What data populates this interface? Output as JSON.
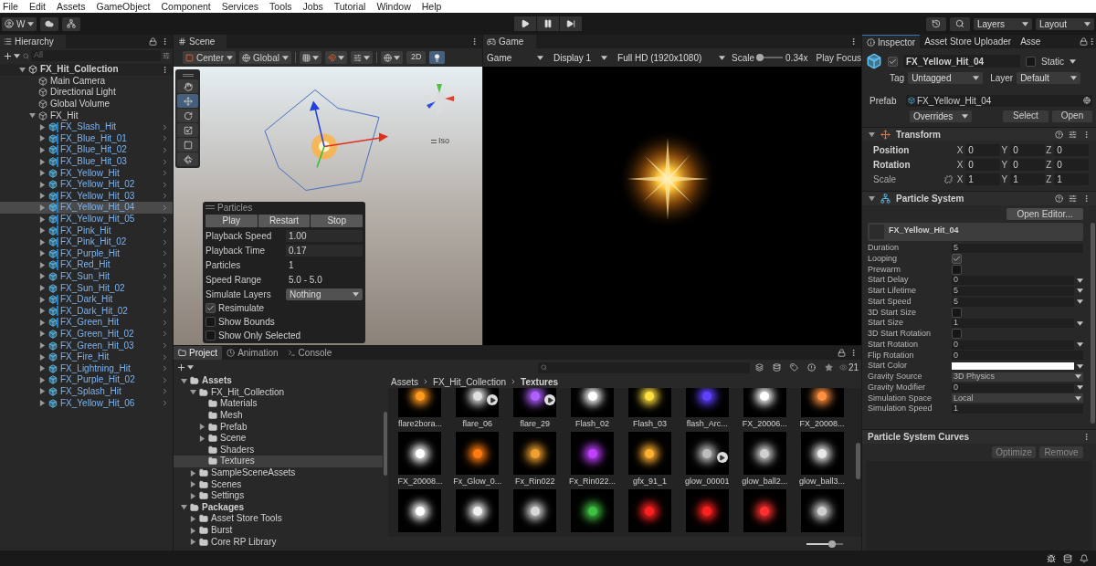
{
  "menu": [
    "File",
    "Edit",
    "Assets",
    "GameObject",
    "Component",
    "Services",
    "Tools",
    "Jobs",
    "Tutorial",
    "Window",
    "Help"
  ],
  "toolbar": {
    "account": "W",
    "layers": "Layers",
    "layout": "Layout"
  },
  "hierarchy": {
    "title": "Hierarchy",
    "search_placeholder": "All",
    "items": [
      {
        "name": "FX_Hit_Collection",
        "kind": "scene",
        "expanded": true,
        "selected": false,
        "marked": false,
        "children": [
          {
            "name": "Main Camera",
            "kind": "object",
            "selected": false,
            "marked": false
          },
          {
            "name": "Directional Light",
            "kind": "object",
            "selected": false,
            "marked": false
          },
          {
            "name": "Global Volume",
            "kind": "object",
            "selected": false,
            "marked": false
          },
          {
            "name": "FX_Hit",
            "kind": "object",
            "expanded": true,
            "selected": false,
            "marked": false,
            "children": [
              {
                "name": "FX_Slash_Hit",
                "kind": "prefab",
                "expanded": false,
                "selected": false,
                "marked": true
              },
              {
                "name": "FX_Blue_Hit_01",
                "kind": "prefab",
                "expanded": false,
                "selected": false,
                "marked": true
              },
              {
                "name": "FX_Blue_Hit_02",
                "kind": "prefab",
                "expanded": false,
                "selected": false,
                "marked": true
              },
              {
                "name": "FX_Blue_Hit_03",
                "kind": "prefab",
                "expanded": false,
                "selected": false,
                "marked": true
              },
              {
                "name": "FX_Yellow_Hit",
                "kind": "prefab",
                "expanded": false,
                "selected": false,
                "marked": false
              },
              {
                "name": "FX_Yellow_Hit_02",
                "kind": "prefab",
                "expanded": false,
                "selected": false,
                "marked": false
              },
              {
                "name": "FX_Yellow_Hit_03",
                "kind": "prefab",
                "expanded": false,
                "selected": false,
                "marked": true
              },
              {
                "name": "FX_Yellow_Hit_04",
                "kind": "prefab",
                "expanded": false,
                "selected": true,
                "marked": true
              },
              {
                "name": "FX_Yellow_Hit_05",
                "kind": "prefab",
                "expanded": false,
                "selected": false,
                "marked": true
              },
              {
                "name": "FX_Pink_Hit",
                "kind": "prefab",
                "expanded": false,
                "selected": false,
                "marked": true
              },
              {
                "name": "FX_Pink_Hit_02",
                "kind": "prefab",
                "expanded": false,
                "selected": false,
                "marked": true
              },
              {
                "name": "FX_Purple_Hit",
                "kind": "prefab",
                "expanded": false,
                "selected": false,
                "marked": true
              },
              {
                "name": "FX_Red_Hit",
                "kind": "prefab",
                "expanded": false,
                "selected": false,
                "marked": true
              },
              {
                "name": "FX_Sun_Hit",
                "kind": "prefab",
                "expanded": false,
                "selected": false,
                "marked": false
              },
              {
                "name": "FX_Sun_Hit_02",
                "kind": "prefab",
                "expanded": false,
                "selected": false,
                "marked": false
              },
              {
                "name": "FX_Dark_Hit",
                "kind": "prefab",
                "expanded": false,
                "selected": false,
                "marked": true
              },
              {
                "name": "FX_Dark_Hit_02",
                "kind": "prefab",
                "expanded": false,
                "selected": false,
                "marked": true
              },
              {
                "name": "FX_Green_Hit",
                "kind": "prefab",
                "expanded": false,
                "selected": false,
                "marked": true
              },
              {
                "name": "FX_Green_Hit_02",
                "kind": "prefab",
                "expanded": false,
                "selected": false,
                "marked": false
              },
              {
                "name": "FX_Green_Hit_03",
                "kind": "prefab",
                "expanded": false,
                "selected": false,
                "marked": false
              },
              {
                "name": "FX_Fire_Hit",
                "kind": "prefab",
                "expanded": false,
                "selected": false,
                "marked": false
              },
              {
                "name": "FX_Lightning_Hit",
                "kind": "prefab",
                "expanded": false,
                "selected": false,
                "marked": false
              },
              {
                "name": "FX_Purple_Hit_02",
                "kind": "prefab",
                "expanded": false,
                "selected": false,
                "marked": false
              },
              {
                "name": "FX_Splash_Hit",
                "kind": "prefab",
                "expanded": false,
                "selected": false,
                "marked": false
              },
              {
                "name": "FX_Yellow_Hit_06",
                "kind": "prefab",
                "expanded": false,
                "selected": false,
                "marked": false
              }
            ]
          }
        ]
      }
    ]
  },
  "scene": {
    "tab": "Scene",
    "pivot": "Center",
    "space": "Global",
    "mode": "2D",
    "lighting": true,
    "iso": "Iso",
    "tools": [
      {
        "kind": "hand",
        "selected": false
      },
      {
        "kind": "move",
        "selected": true
      },
      {
        "kind": "rotate",
        "selected": false
      },
      {
        "kind": "scale",
        "selected": false
      },
      {
        "kind": "rect",
        "selected": false
      },
      {
        "kind": "transform",
        "selected": false
      }
    ]
  },
  "particles": {
    "title": "Particles",
    "buttons": [
      "Play",
      "Restart",
      "Stop"
    ],
    "rows": [
      {
        "kind": "field",
        "label": "Playback Speed",
        "value": "1.00"
      },
      {
        "kind": "field",
        "label": "Playback Time",
        "value": "0.17"
      },
      {
        "kind": "text",
        "label": "Particles",
        "value": "1"
      },
      {
        "kind": "text",
        "label": "Speed Range",
        "value": "5.0 - 5.0"
      },
      {
        "kind": "dropdown",
        "label": "Simulate Layers",
        "value": "Nothing"
      }
    ],
    "checks": [
      {
        "label": "Resimulate",
        "checked": true
      },
      {
        "label": "Show Bounds",
        "checked": false
      },
      {
        "label": "Show Only Selected",
        "checked": false
      }
    ]
  },
  "game": {
    "tab": "Game",
    "view": "Game",
    "display": "Display 1",
    "resolution": "Full HD (1920x1080)",
    "scale_label": "Scale",
    "scale_slider": {
      "level": 0.12
    },
    "scale": "0.34x",
    "play_focus": "Play Focus"
  },
  "inspector": {
    "tabs": [
      {
        "label": "Inspector",
        "selected": true
      },
      {
        "label": "Asset Store Uploader",
        "selected": false
      },
      {
        "label": "Asse",
        "selected": false
      }
    ],
    "active": true,
    "name": "FX_Yellow_Hit_04",
    "static": false,
    "static_label": "Static",
    "tag_label": "Tag",
    "tag": "Untagged",
    "layer_label": "Layer",
    "layer": "Default",
    "prefab_label": "Prefab",
    "prefab": "FX_Yellow_Hit_04",
    "overrides": "Overrides",
    "select": "Select",
    "open": "Open",
    "transform": {
      "title": "Transform",
      "rows": [
        {
          "label": "Position",
          "bold": true,
          "values": [
            {
              "axis": "X",
              "value": "0"
            },
            {
              "axis": "Y",
              "value": "0"
            },
            {
              "axis": "Z",
              "value": "0"
            }
          ]
        },
        {
          "label": "Rotation",
          "bold": true,
          "values": [
            {
              "axis": "X",
              "value": "0"
            },
            {
              "axis": "Y",
              "value": "0"
            },
            {
              "axis": "Z",
              "value": "0"
            }
          ]
        },
        {
          "label": "Scale",
          "bold": false,
          "values": [
            {
              "axis": "X",
              "value": "1"
            },
            {
              "axis": "Y",
              "value": "1"
            },
            {
              "axis": "Z",
              "value": "1"
            }
          ]
        }
      ]
    },
    "particle_system": {
      "title": "Particle System",
      "open_editor": "Open Editor...",
      "module": "FX_Yellow_Hit_04",
      "props": [
        {
          "kind": "field",
          "label": "Duration",
          "value": "5"
        },
        {
          "kind": "check",
          "label": "Looping",
          "checked": true
        },
        {
          "kind": "check",
          "label": "Prewarm",
          "checked": false
        },
        {
          "kind": "curve",
          "label": "Start Delay",
          "value": "0"
        },
        {
          "kind": "curve",
          "label": "Start Lifetime",
          "value": "5"
        },
        {
          "kind": "curve",
          "label": "Start Speed",
          "value": "5"
        },
        {
          "kind": "check",
          "label": "3D Start Size",
          "checked": false
        },
        {
          "kind": "curve",
          "label": "Start Size",
          "value": "1"
        },
        {
          "kind": "check",
          "label": "3D Start Rotation",
          "checked": false
        },
        {
          "kind": "curve",
          "label": "Start Rotation",
          "value": "0"
        },
        {
          "kind": "field",
          "label": "Flip Rotation",
          "value": "0"
        },
        {
          "kind": "color",
          "label": "Start Color",
          "color": "#ffffff"
        },
        {
          "kind": "dropdown",
          "label": "Gravity Source",
          "value": "3D Physics"
        },
        {
          "kind": "curve",
          "label": "Gravity Modifier",
          "value": "0"
        },
        {
          "kind": "dropdown",
          "label": "Simulation Space",
          "value": "Local"
        },
        {
          "kind": "field",
          "label": "Simulation Speed",
          "value": "1"
        }
      ]
    },
    "curves": {
      "title": "Particle System Curves",
      "buttons": [
        "Optimize",
        "Remove"
      ]
    }
  },
  "project": {
    "tabs": [
      {
        "label": "Project",
        "kind": "project",
        "selected": true
      },
      {
        "label": "Animation",
        "kind": "animation",
        "selected": false
      },
      {
        "label": "Console",
        "kind": "console",
        "selected": false
      }
    ],
    "count": "21",
    "thumbnail_size": {
      "level": 0.7
    },
    "tree": [
      {
        "name": "Assets",
        "expanded": true,
        "selected": false,
        "children": [
          {
            "name": "FX_Hit_Collection",
            "expanded": true,
            "selected": false,
            "children": [
              {
                "name": "Materials",
                "selected": false
              },
              {
                "name": "Mesh",
                "selected": false
              },
              {
                "name": "Prefab",
                "expanded": false,
                "selected": false
              },
              {
                "name": "Scene",
                "expanded": false,
                "selected": false
              },
              {
                "name": "Shaders",
                "selected": false
              },
              {
                "name": "Textures",
                "selected": true
              }
            ]
          },
          {
            "name": "SampleSceneAssets",
            "expanded": false,
            "selected": false
          },
          {
            "name": "Scenes",
            "expanded": false,
            "selected": false
          },
          {
            "name": "Settings",
            "expanded": false,
            "selected": false
          }
        ]
      },
      {
        "name": "Packages",
        "expanded": true,
        "selected": false,
        "children": [
          {
            "name": "Asset Store Tools",
            "expanded": false,
            "selected": false
          },
          {
            "name": "Burst",
            "expanded": false,
            "selected": false
          },
          {
            "name": "Core RP Library",
            "expanded": false,
            "selected": false
          }
        ]
      }
    ],
    "breadcrumb": [
      "Assets",
      "FX_Hit_Collection",
      "Textures"
    ],
    "assets": [
      {
        "label": "flare2bora...",
        "color": "#ff9a20",
        "animated": false
      },
      {
        "label": "flare_06",
        "color": "#e0e0e0",
        "animated": true
      },
      {
        "label": "flare_29",
        "color": "#b060ff",
        "animated": true
      },
      {
        "label": "Flash_02",
        "color": "#ffffff",
        "animated": false
      },
      {
        "label": "Flash_03",
        "color": "#ffe040",
        "animated": false
      },
      {
        "label": "flash_Arc...",
        "color": "#6040ff",
        "animated": false
      },
      {
        "label": "FX_20006...",
        "color": "#ffffff",
        "animated": false
      },
      {
        "label": "FX_20008...",
        "color": "#ff9040",
        "animated": false
      },
      {
        "label": "FX_20008...",
        "color": "#ffffff",
        "animated": false
      },
      {
        "label": "Fx_Glow_0...",
        "color": "#ff7a10",
        "animated": false
      },
      {
        "label": "Fx_Rin022",
        "color": "#f0a030",
        "animated": false
      },
      {
        "label": "Fx_Rin022...",
        "color": "#c040ff",
        "animated": false
      },
      {
        "label": "gfx_91_1",
        "color": "#ffb030",
        "animated": false
      },
      {
        "label": "glow_00001",
        "color": "#bdbdbd",
        "animated": true
      },
      {
        "label": "glow_ball2...",
        "color": "#d0d0d0",
        "animated": false
      },
      {
        "label": "glow_ball3...",
        "color": "#e8e8e8",
        "animated": false
      },
      {
        "color": "#ffffff",
        "animated": false
      },
      {
        "color": "#f0f0f0",
        "animated": false
      },
      {
        "color": "#d8d8d8",
        "animated": false
      },
      {
        "color": "#40c040",
        "animated": false
      },
      {
        "color": "#ff2020",
        "animated": false
      },
      {
        "color": "#ff2020",
        "animated": false
      },
      {
        "color": "#ff3030",
        "animated": false
      },
      {
        "color": "#cfcfcf",
        "animated": false
      }
    ]
  }
}
